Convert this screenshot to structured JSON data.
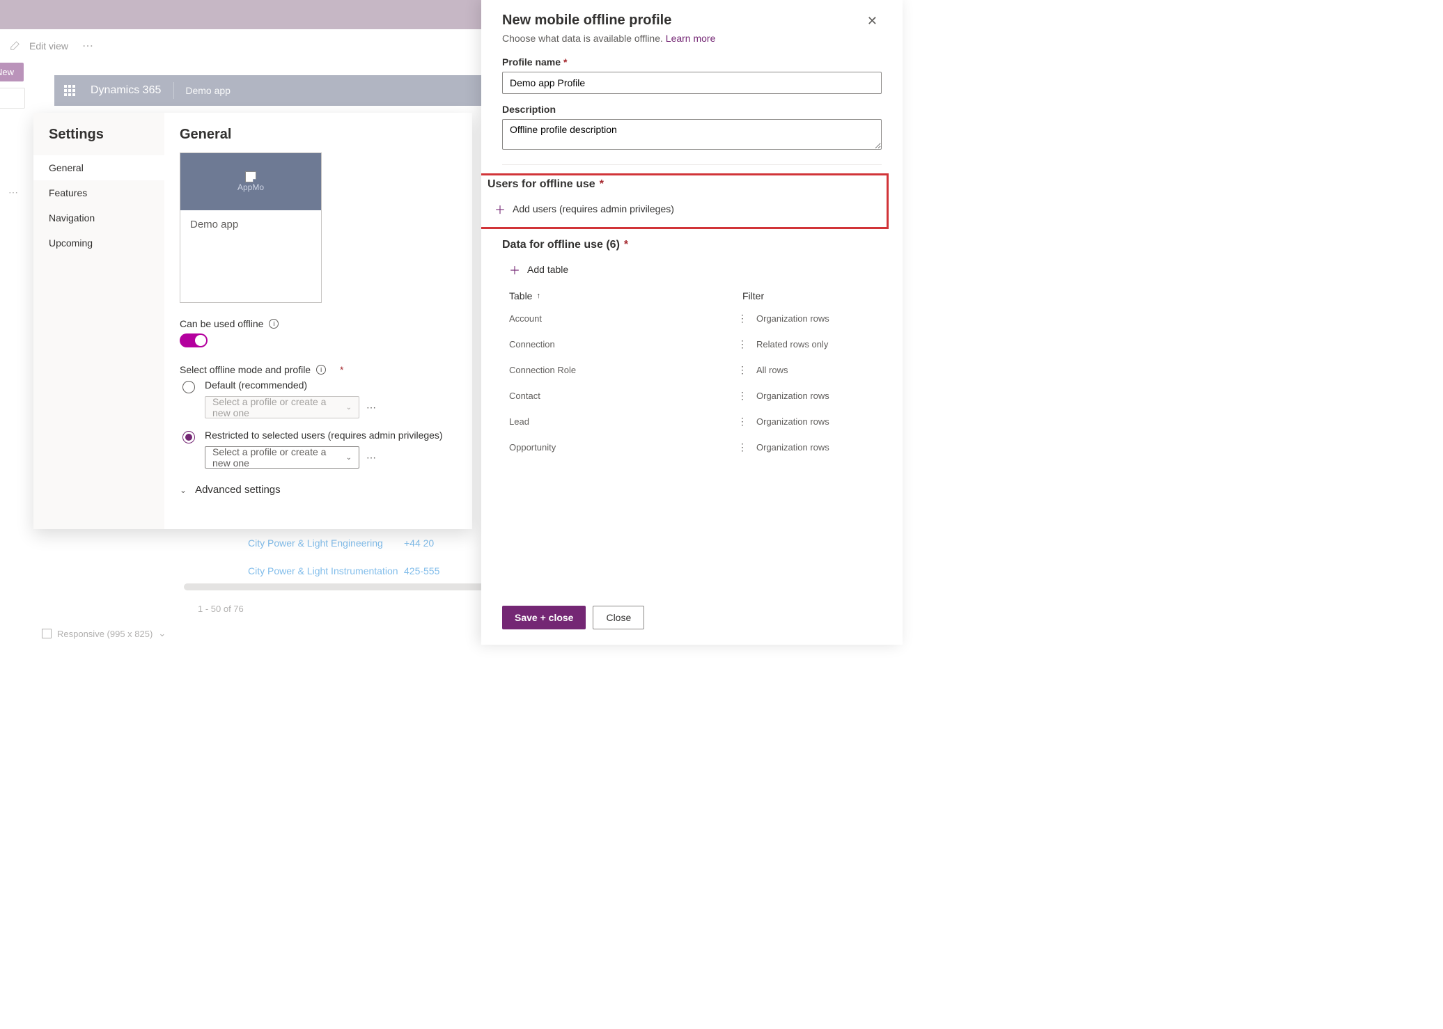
{
  "toolbar": {
    "edit_view": "Edit view"
  },
  "left": {
    "new_btn": "New"
  },
  "app_bar": {
    "brand": "Dynamics 365",
    "app": "Demo app"
  },
  "bg_rows": [
    {
      "name": "City Power & Light Engineering",
      "phone": "+44 20"
    },
    {
      "name": "City Power & Light Instrumentation",
      "phone": "425-555"
    }
  ],
  "pager": "1 - 50 of 76",
  "status": "Responsive (995 x 825)",
  "settings": {
    "title": "Settings",
    "nav": [
      "General",
      "Features",
      "Navigation",
      "Upcoming"
    ],
    "main_heading": "General",
    "tile_img": "AppMo",
    "tile_name": "Demo app",
    "offline_label": "Can be used offline",
    "select_mode_label": "Select offline mode and profile",
    "opt_default": "Default (recommended)",
    "opt_restricted": "Restricted to selected users (requires admin privileges)",
    "profile_placeholder": "Select a profile or create a new one",
    "adv": "Advanced settings"
  },
  "panel": {
    "title": "New mobile offline profile",
    "subtitle": "Choose what data is available offline.",
    "learn_more": "Learn more",
    "name_label": "Profile name",
    "name_value": "Demo app Profile",
    "desc_label": "Description",
    "desc_value": "Offline profile description",
    "users_heading": "Users for offline use",
    "add_users": "Add users (requires admin privileges)",
    "data_heading": "Data for offline use (6)",
    "add_table": "Add table",
    "col_table": "Table",
    "col_filter": "Filter",
    "rows": [
      {
        "t": "Account",
        "f": "Organization rows"
      },
      {
        "t": "Connection",
        "f": "Related rows only"
      },
      {
        "t": "Connection Role",
        "f": "All rows"
      },
      {
        "t": "Contact",
        "f": "Organization rows"
      },
      {
        "t": "Lead",
        "f": "Organization rows"
      },
      {
        "t": "Opportunity",
        "f": "Organization rows"
      }
    ],
    "save": "Save + close",
    "close": "Close"
  }
}
